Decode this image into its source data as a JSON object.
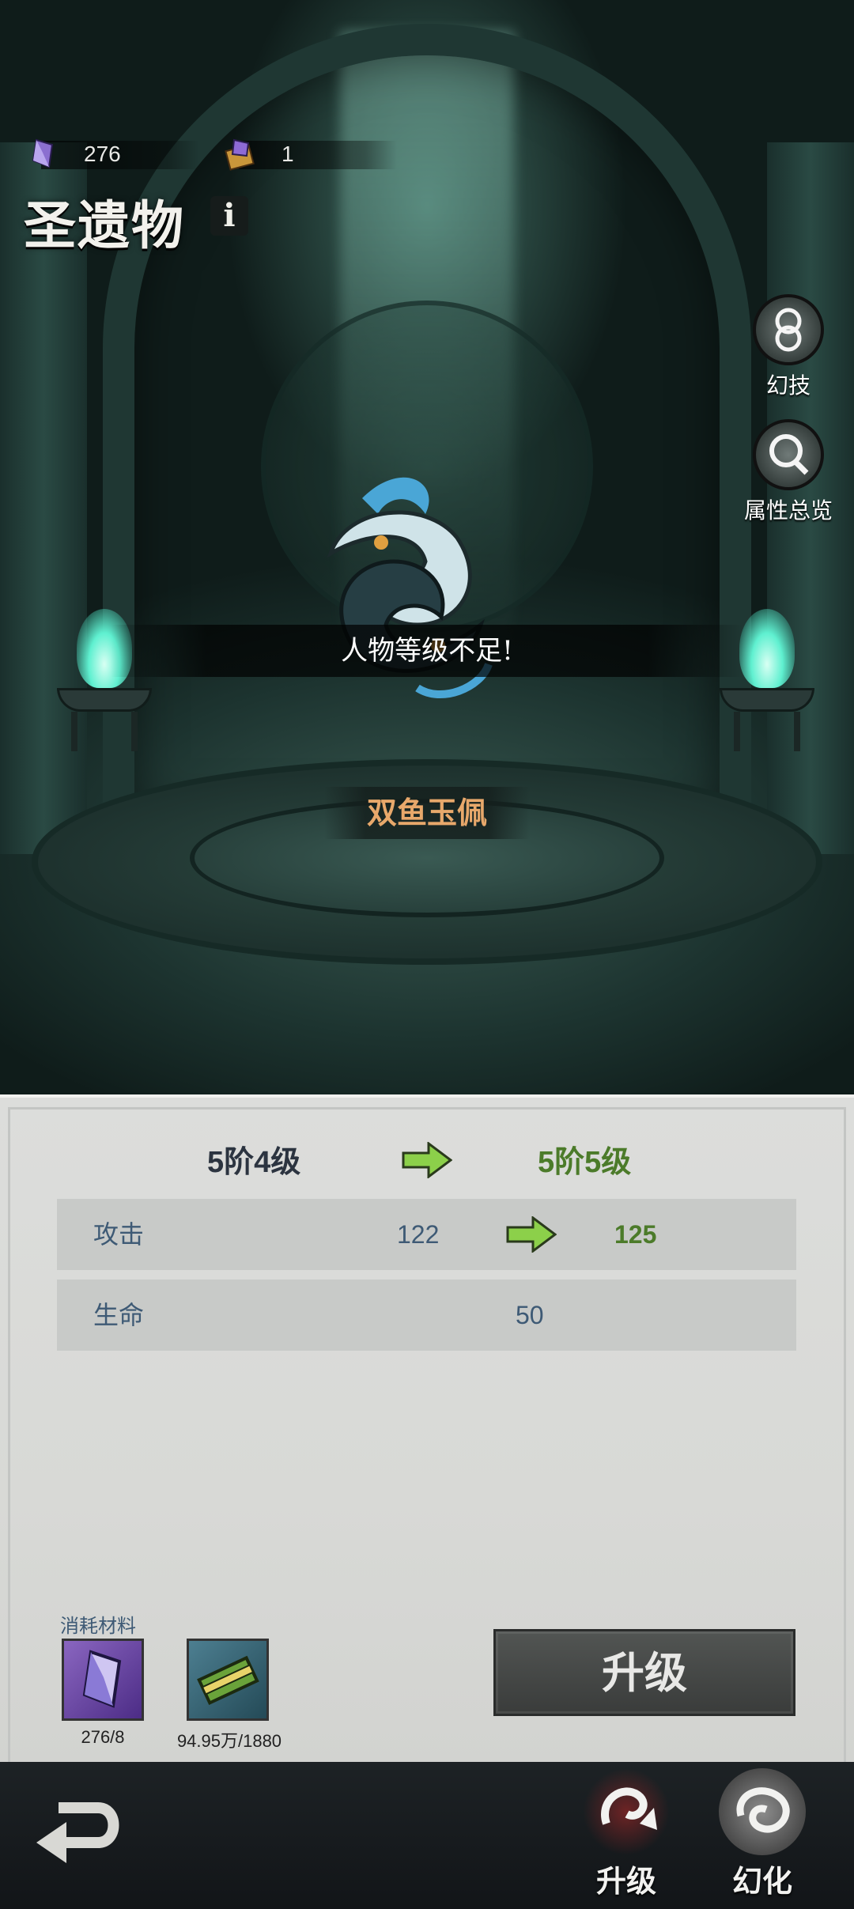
{
  "currency": {
    "crystal": {
      "icon": "crystal-icon",
      "amount": "276"
    },
    "gem_box": {
      "icon": "gem-box-icon",
      "amount": "1"
    }
  },
  "header": {
    "title": "圣遗物",
    "info_glyph": "i"
  },
  "side_buttons": {
    "skill": {
      "label": "幻技",
      "icon": "skill-knot-icon"
    },
    "attributes": {
      "label": "属性总览",
      "icon": "magnifier-icon"
    }
  },
  "relic": {
    "name": "双鱼玉佩",
    "warning": "人物等级不足!",
    "icon": "twin-fish-pendant-icon"
  },
  "upgrade_panel": {
    "level_from": "5阶4级",
    "level_to": "5阶5级",
    "stats": [
      {
        "label": "攻击",
        "from": "122",
        "to": "125"
      },
      {
        "label": "生命",
        "value": "50"
      }
    ],
    "materials_title": "消耗材料",
    "materials": [
      {
        "icon": "crystal-icon",
        "count": "276/8"
      },
      {
        "icon": "cash-stack-icon",
        "count": "94.95万/1880"
      }
    ],
    "upgrade_button": "升级"
  },
  "bottom_nav": {
    "back_icon": "back-arrow-icon",
    "tabs": [
      {
        "label": "升级",
        "icon": "upgrade-swirl-icon",
        "active": true
      },
      {
        "label": "幻化",
        "icon": "illusion-swirl-icon",
        "active": false
      }
    ]
  },
  "colors": {
    "accent_green": "#4c7b2a",
    "stat_blue": "#3e5a75",
    "relic_name_orange": "#e8a86b"
  }
}
